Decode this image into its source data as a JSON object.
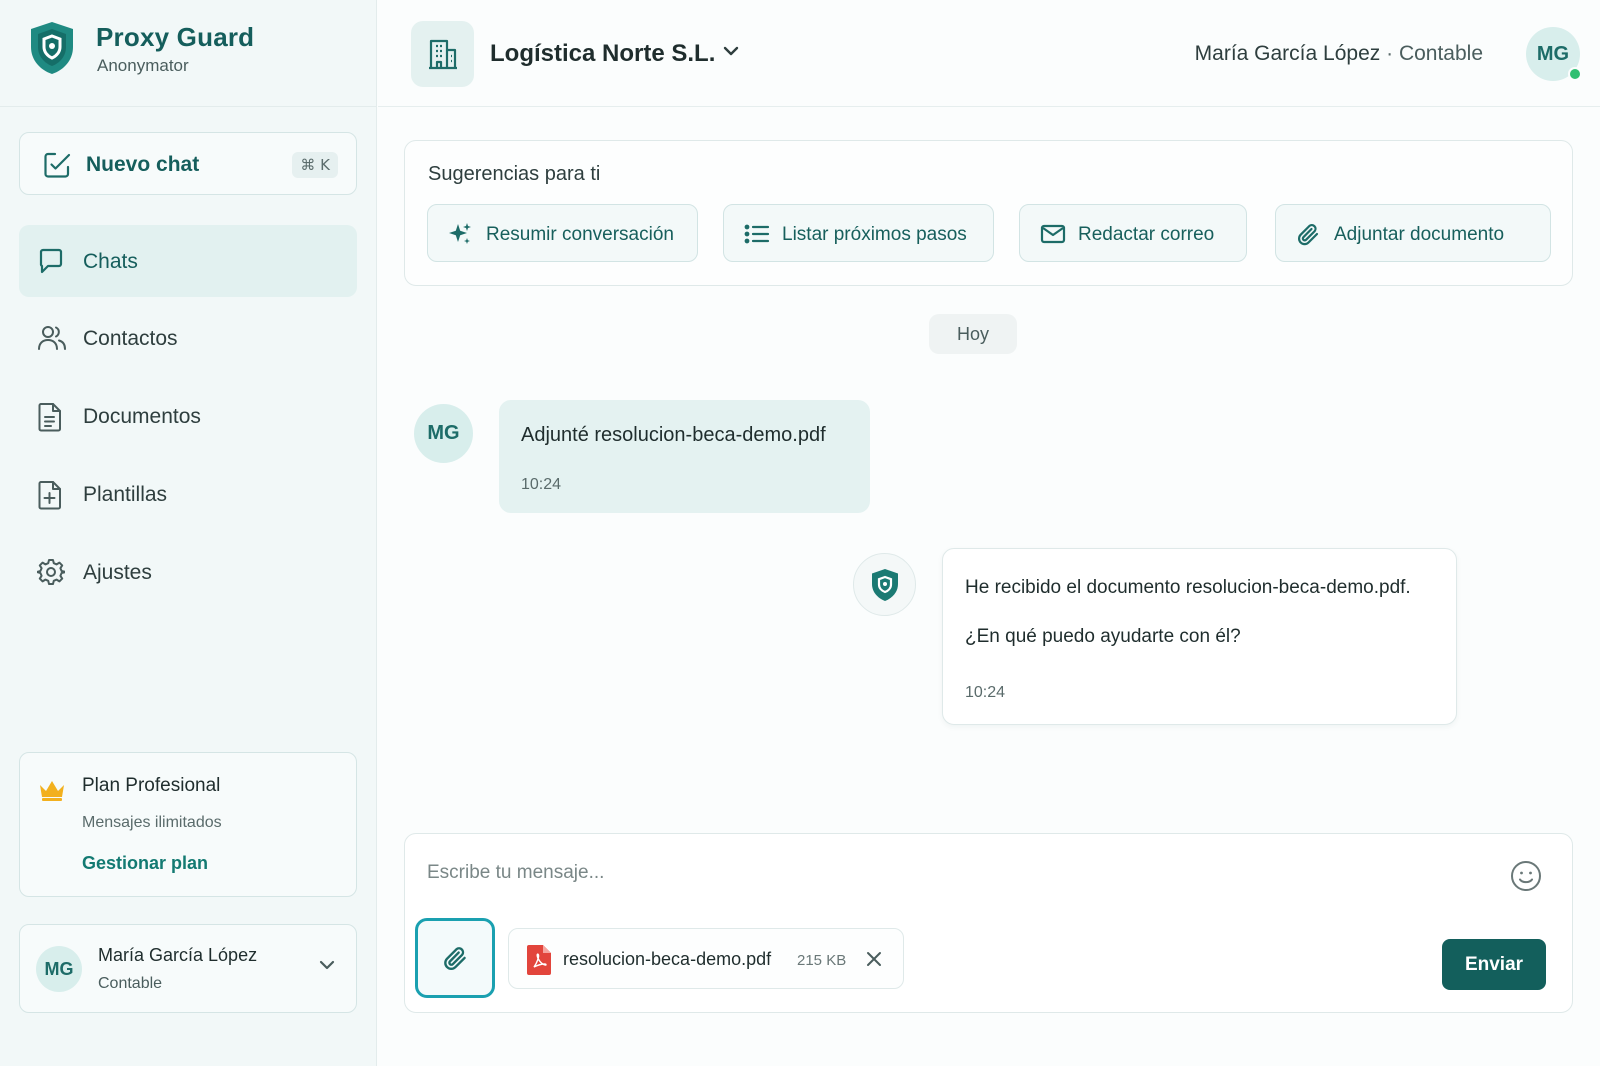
{
  "brand": {
    "name": "Proxy Guard",
    "subtitle": "Anonymator"
  },
  "sidebar": {
    "new_chat": {
      "label": "Nuevo chat",
      "shortcut": "⌘ K"
    },
    "items": [
      {
        "label": "Chats",
        "icon": "chat-bubble-icon",
        "active": true
      },
      {
        "label": "Contactos",
        "icon": "users-icon"
      },
      {
        "label": "Documentos",
        "icon": "document-icon"
      },
      {
        "label": "Plantillas",
        "icon": "template-add-icon"
      },
      {
        "label": "Ajustes",
        "icon": "gear-icon"
      }
    ],
    "plan": {
      "title": "Plan Profesional",
      "subtitle": "Mensajes ilimitados",
      "link": "Gestionar plan"
    },
    "user": {
      "initials": "MG",
      "name": "María García López",
      "role": "Contable"
    }
  },
  "header": {
    "org_name": "Logística Norte S.L.",
    "user_name": "María García López",
    "separator": "·",
    "user_role": "Contable",
    "initials": "MG"
  },
  "suggestions": {
    "title": "Sugerencias para ti",
    "chips": [
      {
        "label": "Resumir conversación",
        "icon": "sparkles-icon"
      },
      {
        "label": "Listar próximos pasos",
        "icon": "list-icon"
      },
      {
        "label": "Redactar correo",
        "icon": "mail-icon"
      },
      {
        "label": "Adjuntar documento",
        "icon": "paperclip-icon"
      }
    ]
  },
  "chat": {
    "day_label": "Hoy",
    "messages": [
      {
        "from": "user",
        "initials": "MG",
        "text": "Adjunté resolucion-beca-demo.pdf",
        "time": "10:24"
      },
      {
        "from": "bot",
        "line1": "He recibido el documento resolucion-beca-demo.pdf.",
        "line2": "¿En qué puedo ayudarte con él?",
        "time": "10:24"
      }
    ]
  },
  "composer": {
    "placeholder": "Escribe tu mensaje...",
    "attachment": {
      "name": "resolucion-beca-demo.pdf",
      "size": "215 KB"
    },
    "send_label": "Enviar"
  },
  "colors": {
    "accent": "#135f5c",
    "accent_light": "#e2f1f0",
    "online": "#2fbf71",
    "pdf": "#e2453c",
    "crown": "#f2b01e"
  }
}
